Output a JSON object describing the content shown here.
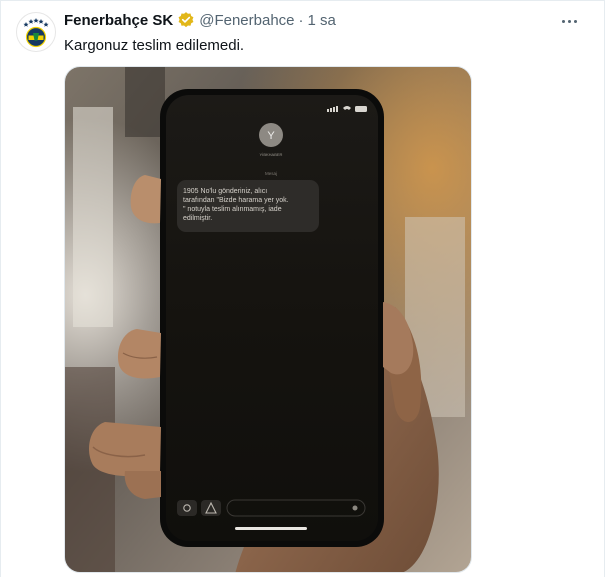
{
  "tweet": {
    "display_name": "Fenerbahçe SK",
    "handle": "@Fenerbahce",
    "separator": "·",
    "time": "1 sa",
    "text": "Kargonuz teslim edilemedi."
  },
  "media": {
    "contact_initial": "Y",
    "contact_name": "YİBKHABER",
    "message_label": "Mesaj",
    "sms_lines": [
      "1905 No'lu gönderiniz, alıcı",
      "tarafından \"Bizde harama yer yok.",
      "\" notuyla teslim alınmamış, iade",
      "edilmiştir."
    ]
  },
  "colors": {
    "verified_badge": "#e2b719",
    "handle_gray": "#536471",
    "club_navy": "#163962",
    "club_yellow": "#f2d200"
  },
  "icons": {
    "more": "more-options-icon",
    "verified": "verified-badge-icon",
    "camera": "camera-icon",
    "appstore": "app-store-icon"
  }
}
